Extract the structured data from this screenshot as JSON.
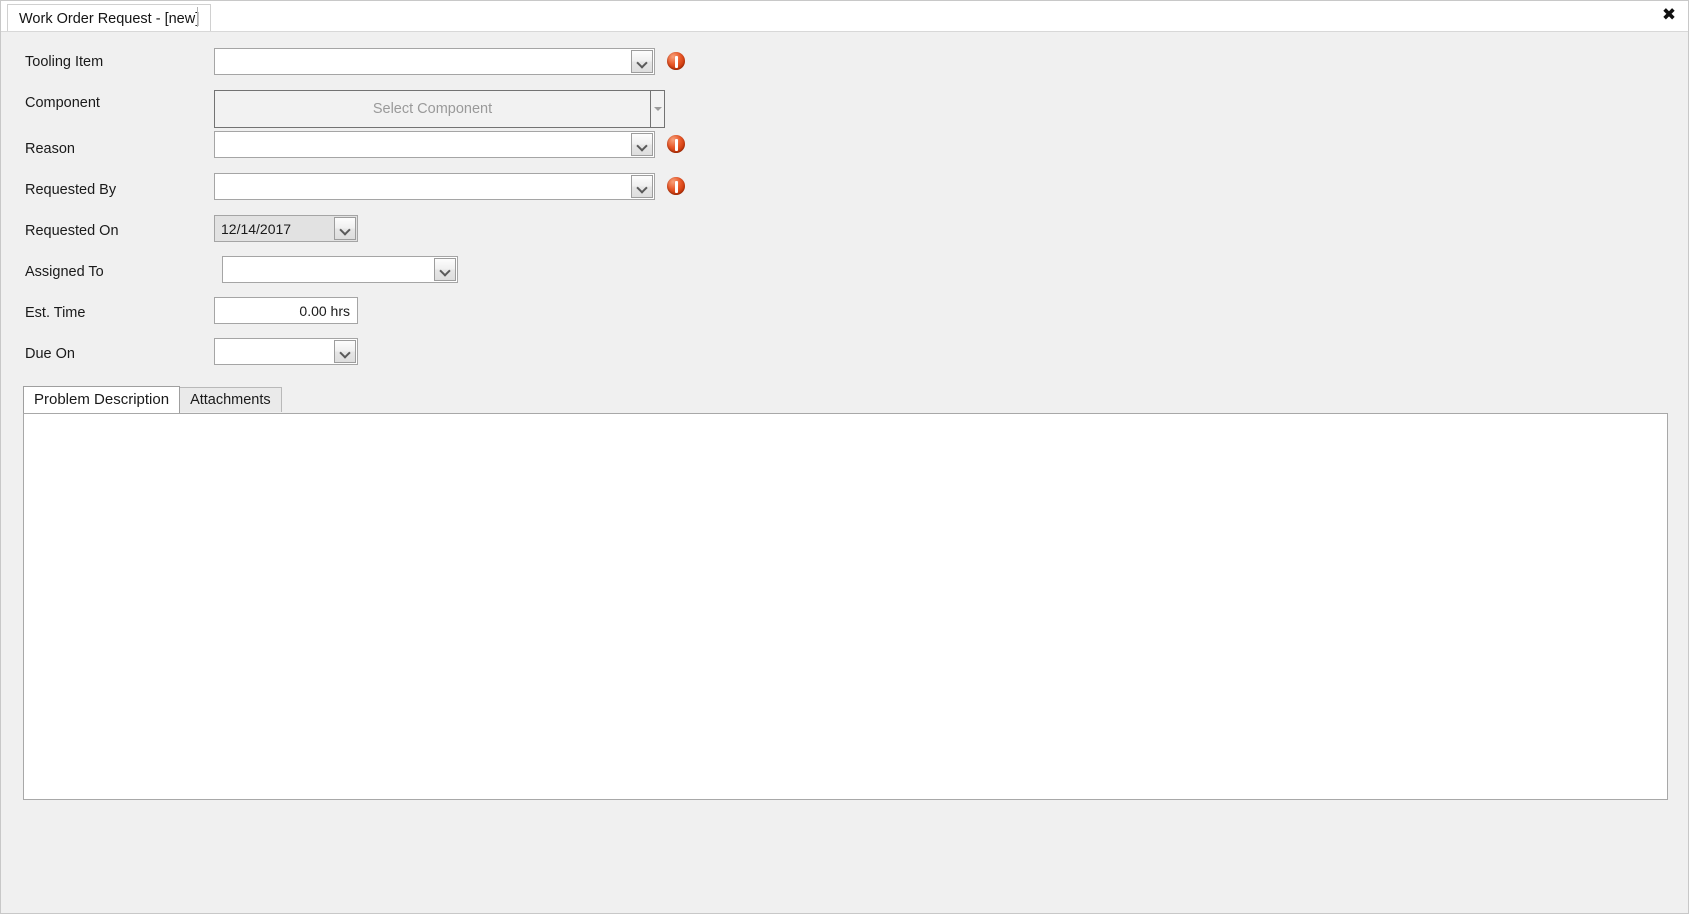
{
  "window": {
    "tab_title": "Work Order Request - [new]",
    "close_label": "✖"
  },
  "form": {
    "fields": [
      {
        "label": "Tooling Item",
        "type": "combo",
        "value": "",
        "required": true
      },
      {
        "label": "Component",
        "type": "picker",
        "value": "",
        "placeholder": "Select Component",
        "required": false
      },
      {
        "label": "Reason",
        "type": "combo",
        "value": "",
        "required": true
      },
      {
        "label": "Requested By",
        "type": "combo",
        "value": "",
        "required": true
      },
      {
        "label": "Requested On",
        "type": "datecombo",
        "value": "12/14/2017",
        "required": false
      },
      {
        "label": "Assigned To",
        "type": "combo",
        "value": "",
        "required": false
      },
      {
        "label": "Est. Time",
        "type": "textbox",
        "value": "0.00 hrs",
        "required": false
      },
      {
        "label": "Due On",
        "type": "datecombo",
        "value": "",
        "required": false
      }
    ]
  },
  "tabs": {
    "items": [
      {
        "label": "Problem Description",
        "active": true
      },
      {
        "label": "Attachments",
        "active": false
      }
    ],
    "problem_description_value": "",
    "problem_description_placeholder": ""
  },
  "icons": {
    "warning": "warning-icon",
    "chevron_down": "chevron-down-icon",
    "close": "close-icon"
  },
  "colors": {
    "window_bg": "#f0f0f0",
    "field_bg": "#ffffff",
    "readonly_bg": "#e2e2e2",
    "warning": "#d8451a",
    "border": "#a5a5a5"
  }
}
